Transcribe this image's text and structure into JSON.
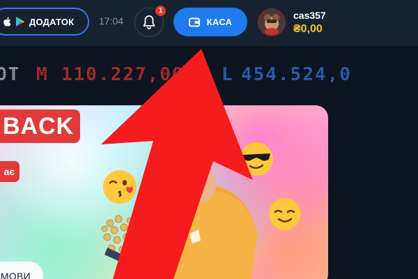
{
  "header": {
    "app_button": {
      "label": "ДОДАТОК",
      "icons": [
        "apple-icon",
        "google-play-icon"
      ]
    },
    "time": "17:04",
    "notifications": {
      "icon": "bell-icon",
      "badge_count": "1"
    },
    "cashier_button": {
      "label": "КАСА",
      "icon": "wallet-icon"
    },
    "user": {
      "avatar_icon": "user-avatar",
      "username": "cas357",
      "balance": "₴0,00"
    }
  },
  "jackpot_ticker": {
    "prefix": "OT",
    "tier_m_label": "M",
    "tier_m_value": "110.227,00",
    "tier_l_label": "L",
    "tier_l_value": "454.524,0",
    "colors": {
      "m": "#d32f2f",
      "l": "#2f6fd6"
    }
  },
  "banner": {
    "title": "BACK",
    "subtitle": "ає",
    "terms_button": "МОВИ"
  },
  "colors": {
    "accent_blue": "#1f7aee",
    "promo_red": "#e23a3a",
    "balance_gold": "#f2c230",
    "overlay_arrow": "#f41c1c"
  }
}
